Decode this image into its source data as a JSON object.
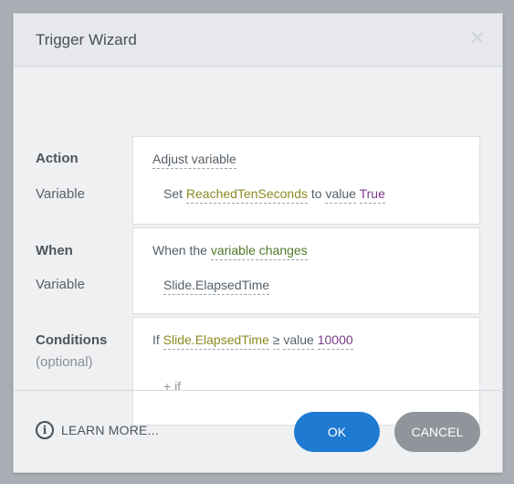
{
  "dialog": {
    "title": "Trigger Wizard",
    "close_glyph": "✕"
  },
  "action": {
    "label": "Action",
    "sublabel": "Variable",
    "type": "Adjust variable",
    "set_word": "Set",
    "variable": "ReachedTenSeconds",
    "to_word": "to",
    "value_word": "value",
    "value": "True"
  },
  "when": {
    "label": "When",
    "sublabel": "Variable",
    "prefix": "When the",
    "event": "variable changes",
    "variable": "Slide.ElapsedTime"
  },
  "conditions": {
    "label": "Conditions",
    "sublabel": "(optional)",
    "if_word": "If",
    "variable": "Slide.ElapsedTime",
    "operator": "≥",
    "value_word": "value",
    "value": "10000",
    "add_if": "+ if"
  },
  "footer": {
    "learn_more": "LEARN MORE...",
    "info_glyph": "i",
    "ok": "OK",
    "cancel": "CANCEL"
  },
  "colors": {
    "ok_button": "#1f7ad1",
    "cancel_button": "#8f959b",
    "variable_name": "#8d8a22",
    "value": "#7b3a86",
    "event": "#4e7a2a"
  }
}
